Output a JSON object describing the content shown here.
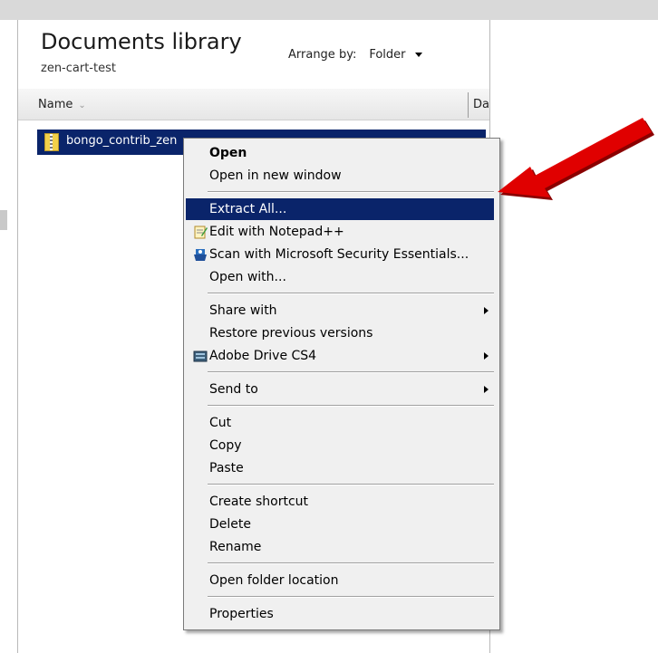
{
  "library": {
    "title": "Documents library",
    "subtitle": "zen-cart-test",
    "arrange_label": "Arrange by:",
    "arrange_value": "Folder"
  },
  "columns": {
    "name": "Name",
    "date": "Da"
  },
  "file": {
    "name": "bongo_contrib_zen"
  },
  "menu": {
    "open": "Open",
    "open_new_window": "Open in new window",
    "extract_all": "Extract All...",
    "edit_notepad": "Edit with Notepad++",
    "scan_mse": "Scan with Microsoft Security Essentials...",
    "open_with": "Open with...",
    "share_with": "Share with",
    "restore_versions": "Restore previous versions",
    "adobe_drive": "Adobe Drive CS4",
    "send_to": "Send to",
    "cut": "Cut",
    "copy": "Copy",
    "paste": "Paste",
    "create_shortcut": "Create shortcut",
    "delete": "Delete",
    "rename": "Rename",
    "open_folder_location": "Open folder location",
    "properties": "Properties"
  },
  "colors": {
    "highlight": "#0a246a",
    "arrow": "#e00000",
    "menu_bg": "#f0f0f0"
  },
  "icons": [
    "notepad-icon",
    "security-essentials-icon",
    "adobe-drive-icon",
    "zip-folder-icon",
    "red-arrow-icon"
  ]
}
